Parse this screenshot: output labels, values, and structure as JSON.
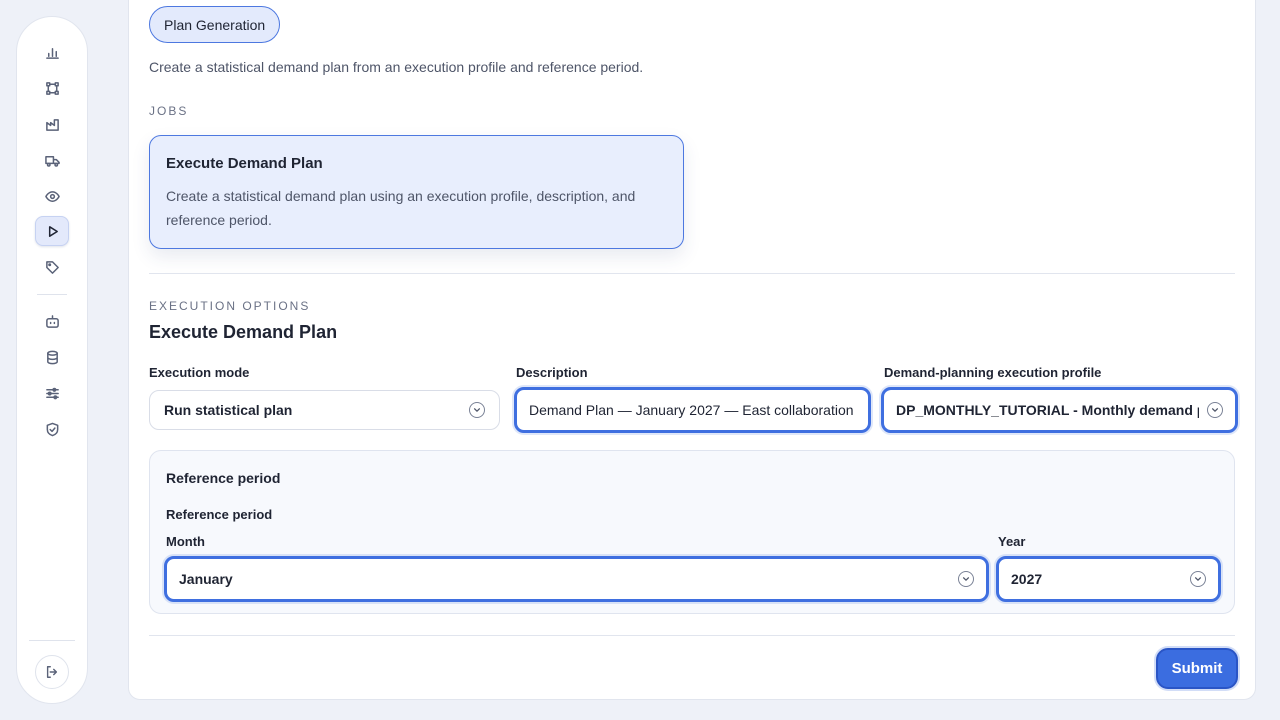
{
  "sidebar": {
    "items": [
      {
        "icon": "bar-chart-icon"
      },
      {
        "icon": "workflow-icon"
      },
      {
        "icon": "factory-icon"
      },
      {
        "icon": "truck-icon"
      },
      {
        "icon": "eye-icon"
      },
      {
        "icon": "play-icon",
        "active": true
      },
      {
        "icon": "tag-icon"
      },
      {
        "icon": "bot-icon"
      },
      {
        "icon": "database-icon"
      },
      {
        "icon": "sliders-icon"
      },
      {
        "icon": "shield-check-icon"
      }
    ],
    "logout_icon": "logout-icon"
  },
  "header": {
    "chip_label": "Plan Generation",
    "intro": "Create a statistical demand plan from an execution profile and reference period."
  },
  "jobs": {
    "section_label": "JOBS",
    "card": {
      "title": "Execute Demand Plan",
      "description": "Create a statistical demand plan using an execution profile, description, and reference period."
    }
  },
  "options": {
    "section_label": "EXECUTION OPTIONS",
    "title": "Execute Demand Plan",
    "execution_mode": {
      "label": "Execution mode",
      "value": "Run statistical plan"
    },
    "description": {
      "label": "Description",
      "value": "Demand Plan — January 2027 — East collaboration"
    },
    "profile": {
      "label": "Demand-planning execution profile",
      "value": "DP_MONTHLY_TUTORIAL - Monthly demand plan"
    },
    "reference": {
      "box_title": "Reference period",
      "group_label": "Reference period",
      "month": {
        "label": "Month",
        "value": "January"
      },
      "year": {
        "label": "Year",
        "value": "2027"
      }
    }
  },
  "actions": {
    "submit_label": "Submit"
  },
  "colors": {
    "accent": "#3b6de0",
    "selected_card_bg": "#e8eefd",
    "page_bg": "#eef1f8"
  }
}
